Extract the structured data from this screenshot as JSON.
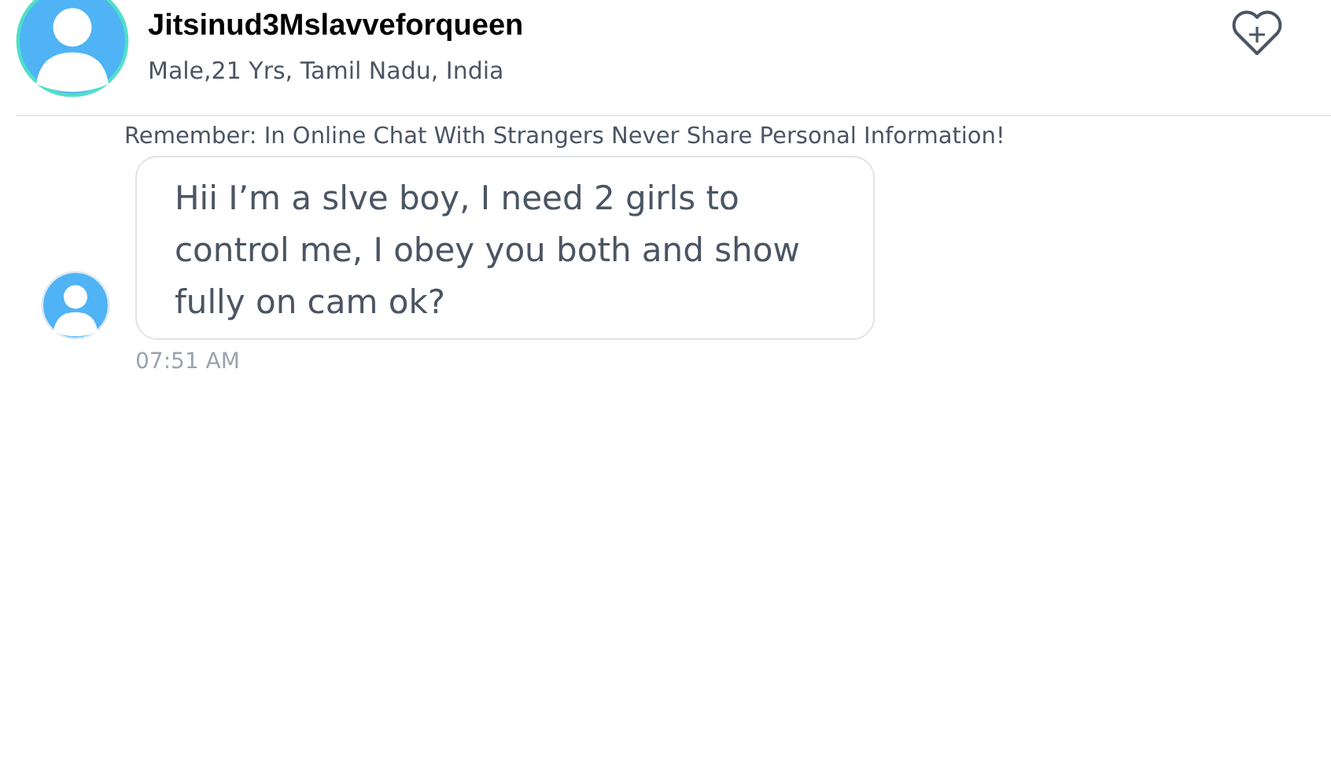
{
  "profile": {
    "name": "Jitsinud3Mslavveforqueen",
    "details": "Male,21 Yrs, Tamil Nadu, India"
  },
  "notice": "Remember: In Online Chat With Strangers Never Share Personal Information!",
  "messages": [
    {
      "text": "Hii I’m a slve boy, I need 2 girls to control me, I obey you both and show fully on cam ok?",
      "time": "07:51 AM"
    }
  ]
}
